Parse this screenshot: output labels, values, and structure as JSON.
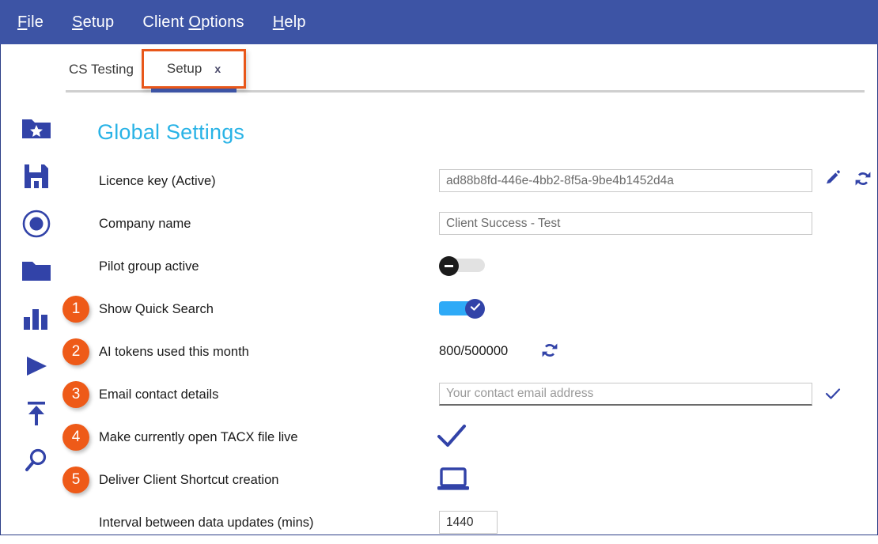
{
  "menu": {
    "items": [
      {
        "name": "file",
        "pre": "",
        "accel": "F",
        "post": "ile"
      },
      {
        "name": "setup",
        "pre": "",
        "accel": "S",
        "post": "etup"
      },
      {
        "name": "client-options",
        "pre": "Client ",
        "accel": "O",
        "post": "ptions"
      },
      {
        "name": "help",
        "pre": "",
        "accel": "H",
        "post": "elp"
      }
    ]
  },
  "tabs": {
    "inactive_label": "CS Testing",
    "active_label": "Setup",
    "close_label": "x"
  },
  "sidebar": {
    "items": [
      {
        "icon": "folder-star-icon"
      },
      {
        "icon": "save-floppy-icon"
      },
      {
        "icon": "record-circle-icon"
      },
      {
        "icon": "folder-icon"
      },
      {
        "icon": "bar-chart-icon"
      },
      {
        "icon": "play-icon"
      },
      {
        "icon": "upload-icon"
      },
      {
        "icon": "search-icon"
      }
    ]
  },
  "page": {
    "title": "Global Settings"
  },
  "settings": [
    {
      "label": "Licence key (Active)",
      "badge": null,
      "control": "text",
      "value": "ad88b8fd-446e-4bb2-8f5a-9be4b1452d4a",
      "placeholder": "",
      "trailing_icons": [
        "pencil-icon",
        "refresh-icon"
      ]
    },
    {
      "label": "Company name",
      "badge": null,
      "control": "text",
      "value": "Client Success - Test",
      "placeholder": "",
      "trailing_icons": []
    },
    {
      "label": "Pilot group active",
      "badge": null,
      "control": "toggle",
      "state": "off",
      "trailing_icons": []
    },
    {
      "label": "Show Quick Search",
      "badge": "1",
      "control": "toggle",
      "state": "on",
      "trailing_icons": []
    },
    {
      "label": "AI tokens used this month",
      "badge": "2",
      "control": "static",
      "value": "800/500000",
      "trailing_icons": [
        "refresh-icon"
      ]
    },
    {
      "label": "Email contact details",
      "badge": "3",
      "control": "text",
      "value": "",
      "placeholder": "Your contact email address",
      "trailing_icons": [
        "check-icon"
      ]
    },
    {
      "label": "Make currently open TACX file live",
      "badge": "4",
      "control": "check",
      "trailing_icons": []
    },
    {
      "label": "Deliver Client Shortcut creation",
      "badge": "5",
      "control": "laptop",
      "trailing_icons": []
    },
    {
      "label": "Interval between data updates (mins)",
      "badge": null,
      "control": "number",
      "value": "1440",
      "placeholder": "",
      "trailing_icons": []
    }
  ],
  "colors": {
    "header_blue": "#3d54a5",
    "accent_cyan": "#29b3e6",
    "badge_orange": "#ee5a18",
    "annotation_orange": "#e8571a",
    "icon_blue": "#3243a8",
    "toggle_on": "#2eaaf7"
  }
}
